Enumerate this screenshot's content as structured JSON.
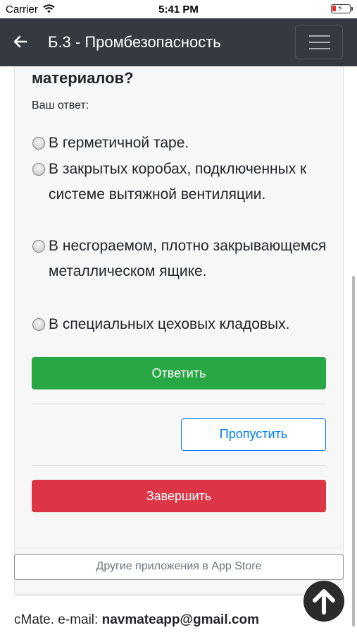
{
  "status_bar": {
    "carrier": "Carrier",
    "time": "5:41 PM"
  },
  "navbar": {
    "title": "Б.3 - Промбезопасность"
  },
  "question": {
    "tail_text": "материалов?",
    "answer_label": "Ваш ответ:",
    "options": [
      "В герметичной таре.",
      "В закрытых коробах, подключенных к системе вытяжной вентиляции.",
      "В несгораемом, плотно закрывающемся металлическом ящике.",
      "В специальных цеховых кладовых."
    ]
  },
  "buttons": {
    "answer": "Ответить",
    "skip": "Пропустить",
    "finish": "Завершить",
    "other_apps": "Другие приложения в App Store"
  },
  "footer": {
    "prefix": "cMate. e-mail: ",
    "email": "navmateapp@gmail.com"
  },
  "colors": {
    "navbar": "#343a40",
    "success": "#28a745",
    "danger": "#dc3545",
    "primary": "#007bff"
  },
  "icons": {
    "back": "arrow-left-icon",
    "menu": "hamburger-menu-icon",
    "scroll_top": "arrow-up-circle-icon",
    "wifi": "wifi-icon",
    "battery": "battery-charging-icon"
  }
}
